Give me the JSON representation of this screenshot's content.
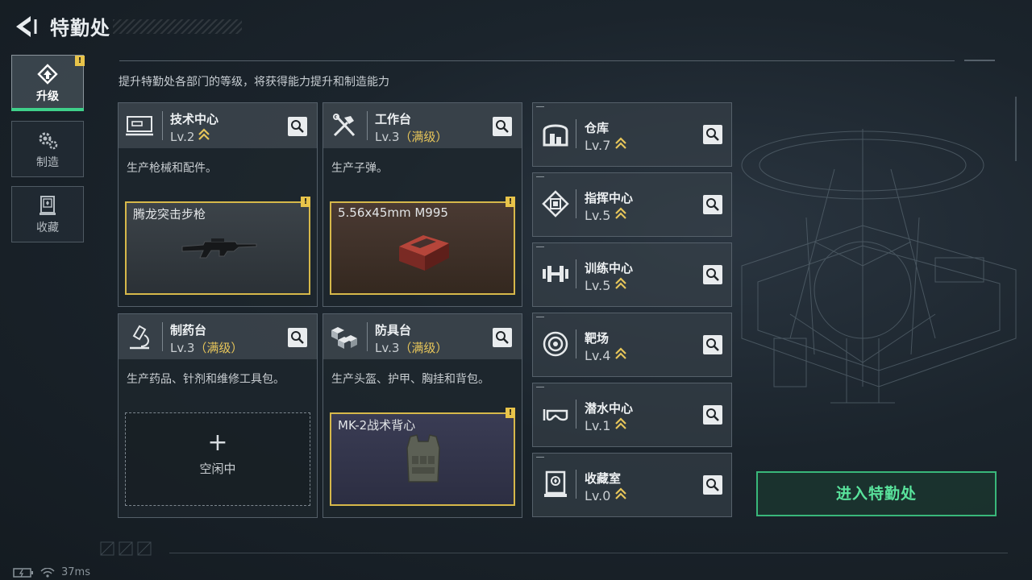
{
  "header": {
    "back_icon": "chevron-left-icon",
    "title": "特勤处",
    "subtitle": "提升特勤处各部门的等级，将获得能力提升和制造能力"
  },
  "tabs": [
    {
      "label": "升级",
      "icon": "upgrade-icon",
      "active": true,
      "alert": "!"
    },
    {
      "label": "制造",
      "icon": "gears-icon",
      "active": false
    },
    {
      "label": "收藏",
      "icon": "collection-icon",
      "active": false
    }
  ],
  "cards": [
    {
      "name": "技术中心",
      "level": "Lv.2",
      "maxed": "",
      "desc": "生产枪械和配件。",
      "icon": "monitor-icon",
      "product": {
        "name": "腾龙突击步枪",
        "alert": "!",
        "image": "rifle"
      }
    },
    {
      "name": "工作台",
      "level": "Lv.3",
      "maxed": "（满级）",
      "desc": "生产子弹。",
      "icon": "tools-icon",
      "product": {
        "name": "5.56x45mm M995",
        "alert": "!",
        "image": "ammo-box"
      }
    },
    {
      "name": "制药台",
      "level": "Lv.3",
      "maxed": "（满级）",
      "desc": "生产药品、针剂和维修工具包。",
      "icon": "microscope-icon",
      "idle": {
        "symbol": "+",
        "label": "空闲中"
      }
    },
    {
      "name": "防具台",
      "level": "Lv.3",
      "maxed": "（满级）",
      "desc": "生产头盔、护甲、胸挂和背包。",
      "icon": "cubes-icon",
      "product": {
        "name": "MK-2战术背心",
        "alert": "!",
        "image": "vest"
      }
    }
  ],
  "facilities": [
    {
      "name": "仓库",
      "level": "Lv.7",
      "icon": "warehouse-icon"
    },
    {
      "name": "指挥中心",
      "level": "Lv.5",
      "icon": "chip-icon"
    },
    {
      "name": "训练中心",
      "level": "Lv.5",
      "icon": "dumbbell-icon"
    },
    {
      "name": "靶场",
      "level": "Lv.4",
      "icon": "target-icon"
    },
    {
      "name": "潜水中心",
      "level": "Lv.1",
      "icon": "goggles-icon"
    },
    {
      "name": "收藏室",
      "level": "Lv.0",
      "icon": "vault-icon"
    }
  ],
  "enter_button": "进入特勤处",
  "status": {
    "ping": "37ms"
  },
  "colors": {
    "accent_green": "#39b77a",
    "highlight_gold": "#d6b84a",
    "maxed_text": "#e6c55a"
  }
}
